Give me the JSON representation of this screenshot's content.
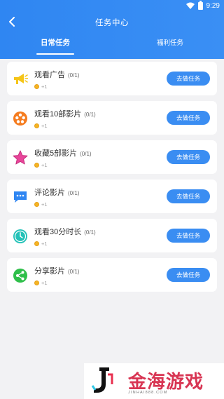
{
  "status": {
    "time": "9:29"
  },
  "header": {
    "title": "任务中心"
  },
  "tabs": {
    "daily": "日常任务",
    "welfare": "福利任务"
  },
  "tasks": [
    {
      "title": "观看广告",
      "count": "(0/1)",
      "reward": "+1",
      "action": "去做任务",
      "icon": "megaphone-icon",
      "color": "#f5c518"
    },
    {
      "title": "观看10部影片",
      "count": "(0/1)",
      "reward": "+1",
      "action": "去做任务",
      "icon": "film-reel-icon",
      "color": "#f57c1f"
    },
    {
      "title": "收藏5部影片",
      "count": "(0/1)",
      "reward": "+1",
      "action": "去做任务",
      "icon": "star-icon",
      "color": "#e8459a"
    },
    {
      "title": "评论影片",
      "count": "(0/1)",
      "reward": "+1",
      "action": "去做任务",
      "icon": "comment-icon",
      "color": "#2f86f2"
    },
    {
      "title": "观看30分时长",
      "count": "(0/1)",
      "reward": "+1",
      "action": "去做任务",
      "icon": "clock-icon",
      "color": "#23c2b8"
    },
    {
      "title": "分享影片",
      "count": "(0/1)",
      "reward": "+1",
      "action": "去做任务",
      "icon": "share-icon",
      "color": "#2fbf4a"
    }
  ],
  "watermark": {
    "text": "金海游戏",
    "url": "JINHAI888.COM"
  }
}
